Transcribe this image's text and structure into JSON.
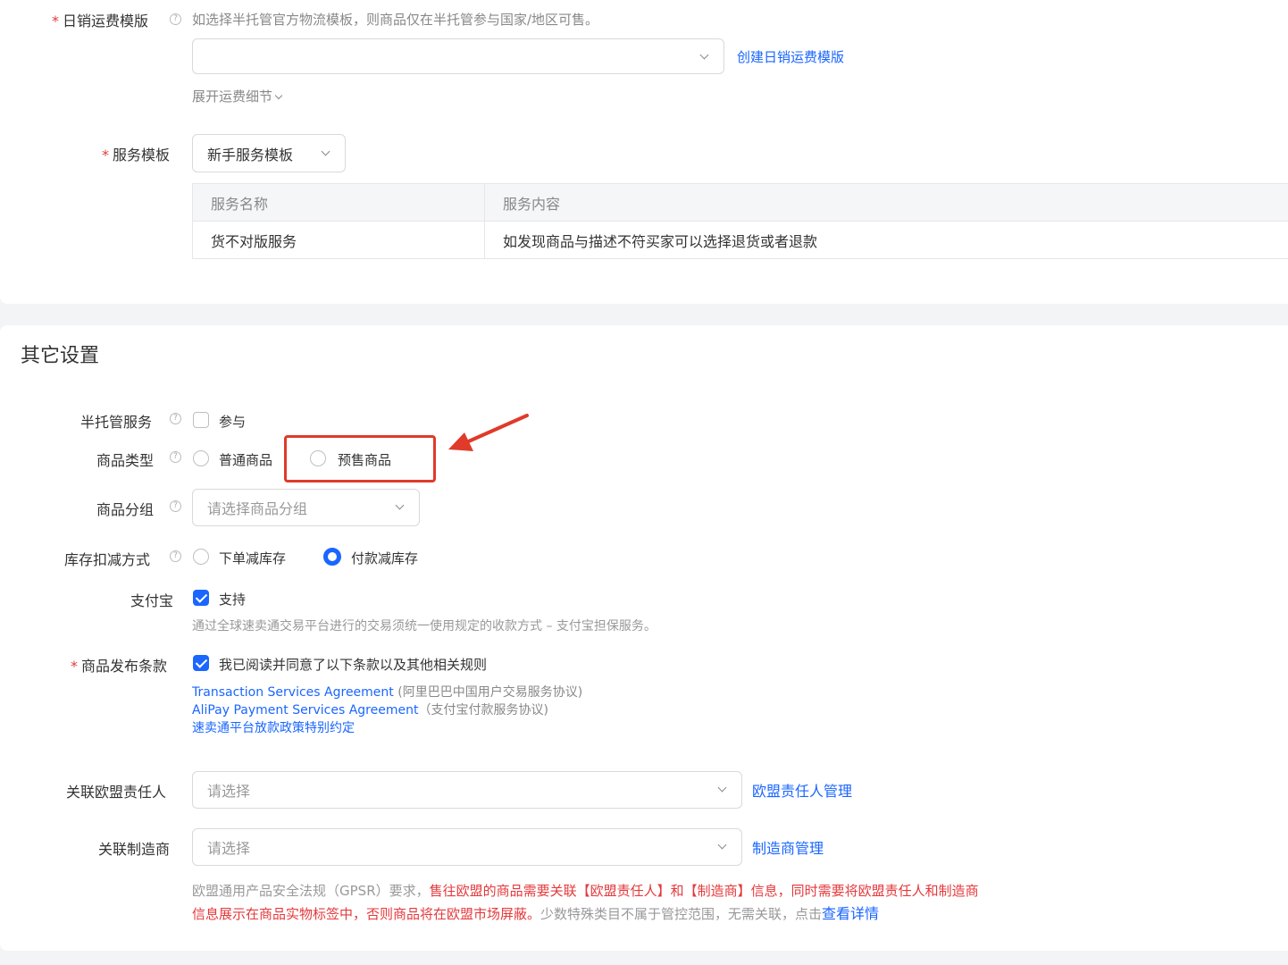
{
  "shipping": {
    "label": "日销运费模版",
    "hint": "如选择半托管官方物流模板，则商品仅在半托管参与国家/地区可售。",
    "create_link": "创建日销运费模版",
    "expand": "展开运费细节"
  },
  "service": {
    "label": "服务模板",
    "selected": "新手服务模板",
    "table": {
      "headers": [
        "服务名称",
        "服务内容"
      ],
      "rows": [
        [
          "货不对版服务",
          "如发现商品与描述不符买家可以选择退货或者退款"
        ]
      ]
    }
  },
  "other": {
    "title": "其它设置",
    "semi_managed": {
      "label": "半托管服务",
      "option": "参与",
      "checked": false
    },
    "product_type": {
      "label": "商品类型",
      "options": [
        "普通商品",
        "预售商品"
      ],
      "selected": null
    },
    "product_group": {
      "label": "商品分组",
      "placeholder": "请选择商品分组"
    },
    "stock": {
      "label": "库存扣减方式",
      "options": [
        "下单减库存",
        "付款减库存"
      ],
      "selected": "付款减库存"
    },
    "alipay": {
      "label": "支付宝",
      "option": "支持",
      "checked": true,
      "note": "通过全球速卖通交易平台进行的交易须统一使用规定的收款方式 – 支付宝担保服务。"
    },
    "terms": {
      "label": "商品发布条款",
      "option": "我已阅读并同意了以下条款以及其他相关规则",
      "checked": true,
      "links": [
        {
          "text": "Transaction Services Agreement",
          "suffix": " (阿里巴巴中国用户交易服务协议)"
        },
        {
          "text": "AliPay Payment Services Agreement",
          "suffix": "（支付宝付款服务协议)"
        },
        {
          "text": "速卖通平台放款政策特别约定",
          "suffix": ""
        }
      ]
    },
    "eu_rep": {
      "label": "关联欧盟责任人",
      "placeholder": "请选择",
      "link": "欧盟责任人管理"
    },
    "manufacturer": {
      "label": "关联制造商",
      "placeholder": "请选择",
      "link": "制造商管理"
    },
    "gpsr": {
      "line1_gray": "欧盟通用产品安全法规（GPSR）要求，",
      "line1_red": "售往欧盟的商品需要关联【欧盟责任人】和【制造商】信息，同时需要将欧盟责任人和制造商",
      "line2_red": "信息展示在商品实物标签中，否则商品将在欧盟市场屏蔽。",
      "line2_gray": "少数特殊类目不属于管控范围，无需关联，点击",
      "line2_link": "查看详情"
    }
  },
  "colors": {
    "accent": "#1a66ff",
    "required": "#e4393c",
    "annotation": "#e03a2a"
  }
}
